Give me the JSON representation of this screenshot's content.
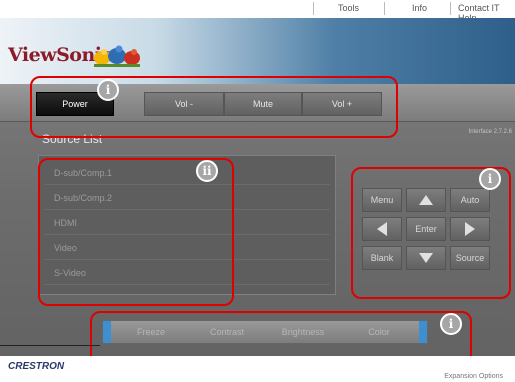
{
  "top_links": [
    "Tools",
    "Info",
    "Contact IT Help"
  ],
  "header": {
    "brand": "ViewSonic"
  },
  "power_bar": {
    "power": "Power",
    "vol_down": "Vol -",
    "mute": "Mute",
    "vol_up": "Vol +"
  },
  "version": "Interface 2.7.2.6",
  "source_list": {
    "title": "Source List",
    "items": [
      "D-sub/Comp.1",
      "D-sub/Comp.2",
      "HDMI",
      "Video",
      "S-Video"
    ]
  },
  "keypad": {
    "menu": "Menu",
    "auto": "Auto",
    "enter": "Enter",
    "blank": "Blank",
    "source": "Source"
  },
  "bottom_bar": [
    "Freeze",
    "Contrast",
    "Brightness",
    "Color"
  ],
  "badges": {
    "power": "i",
    "source": "ii",
    "keypad": "i",
    "bottom": "i"
  },
  "footer": {
    "brand": "CRESTRON",
    "expansion": "Expansion Options"
  },
  "colors": {
    "annotation": "#e00000",
    "brand": "#8c1b2a",
    "accent": "#3c8fd0"
  }
}
